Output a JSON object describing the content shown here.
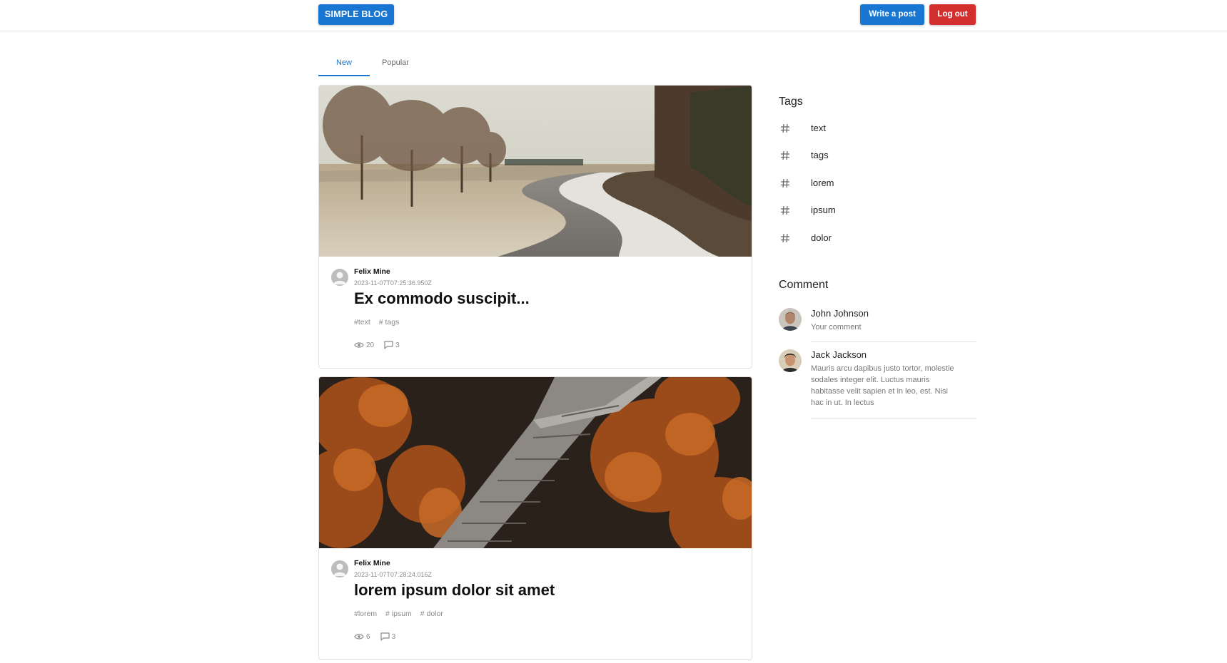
{
  "header": {
    "brand": "SIMPLE BLOG",
    "write_label": "Write a post",
    "logout_label": "Log out"
  },
  "tabs": [
    {
      "label": "New",
      "active": true
    },
    {
      "label": "Popular",
      "active": false
    }
  ],
  "posts": [
    {
      "author": "Felix Mine",
      "date": "2023-11-07T07:25:36.950Z",
      "title": "Ex commodo suscipit...",
      "tags": [
        "#text",
        "# tags"
      ],
      "views": "20",
      "comments": "3",
      "image": "autumn road through frosty park"
    },
    {
      "author": "Felix Mine",
      "date": "2023-11-07T07:28:24.016Z",
      "title": "lorem ipsum dolor sit amet",
      "tags": [
        "#lorem",
        "# ipsum",
        "# dolor"
      ],
      "views": "6",
      "comments": "3",
      "image": "wooden boardwalk through orange autumn trees"
    }
  ],
  "sidebar": {
    "tags_title": "Tags",
    "tags": [
      "text",
      "tags",
      "lorem",
      "ipsum",
      "dolor"
    ],
    "comments_title": "Comment",
    "comments": [
      {
        "name": "John Johnson",
        "text": "Your comment"
      },
      {
        "name": "Jack Jackson",
        "text": "Mauris arcu dapibus justo tortor, molestie sodales integer elit. Luctus mauris habitasse velit sapien et in leo, est. Nisi hac in ut. In lectus"
      }
    ]
  },
  "colors": {
    "primary": "#1976d2",
    "danger": "#d32f2f",
    "divider": "#e0e0e0",
    "muted": "#8a8a8a"
  },
  "icons": {
    "tag": "hash-icon",
    "views": "eye-icon",
    "comments": "comment-icon",
    "avatar": "person-avatar-icon"
  }
}
